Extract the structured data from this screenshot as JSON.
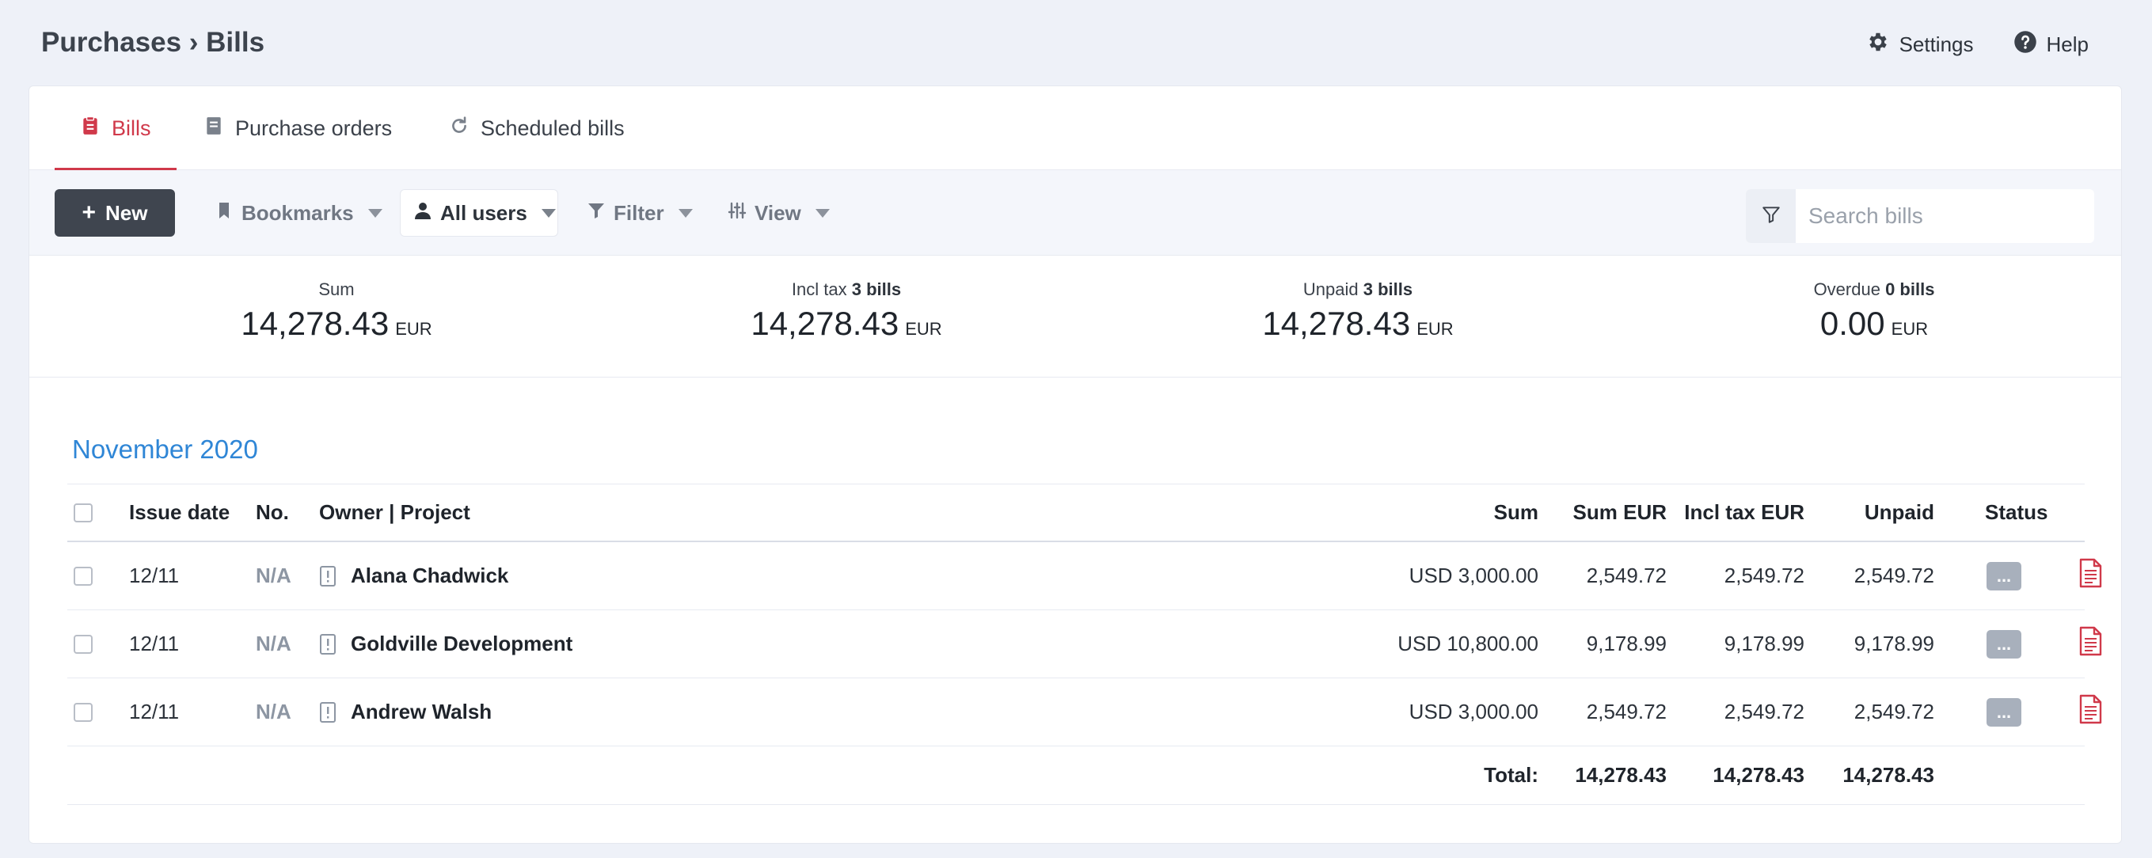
{
  "header": {
    "breadcrumb": "Purchases › Bills",
    "settings_label": "Settings",
    "help_label": "Help"
  },
  "tabs": [
    {
      "label": "Bills",
      "icon": "bills-icon",
      "active": true
    },
    {
      "label": "Purchase orders",
      "icon": "document-icon",
      "active": false
    },
    {
      "label": "Scheduled bills",
      "icon": "refresh-icon",
      "active": false
    }
  ],
  "toolbar": {
    "new_label": "New",
    "bookmarks_label": "Bookmarks",
    "users_label": "All users",
    "filter_label": "Filter",
    "view_label": "View",
    "search_placeholder": "Search bills"
  },
  "summary": {
    "sum": {
      "label": "Sum",
      "count": "",
      "value": "14,278.43",
      "currency": "EUR"
    },
    "incl_tax": {
      "label": "Incl tax",
      "count": "3 bills",
      "value": "14,278.43",
      "currency": "EUR"
    },
    "unpaid": {
      "label": "Unpaid",
      "count": "3 bills",
      "value": "14,278.43",
      "currency": "EUR"
    },
    "overdue": {
      "label": "Overdue",
      "count": "0 bills",
      "value": "0.00",
      "currency": "EUR"
    }
  },
  "month": "November 2020",
  "table": {
    "headers": {
      "issue_date": "Issue date",
      "no": "No.",
      "owner_project": "Owner | Project",
      "sum": "Sum",
      "sum_eur": "Sum EUR",
      "incl_tax_eur": "Incl tax EUR",
      "unpaid": "Unpaid",
      "status": "Status"
    },
    "rows": [
      {
        "date": "12/11",
        "no": "N/A",
        "owner": "Alana Chadwick",
        "sum": "USD 3,000.00",
        "sum_eur": "2,549.72",
        "incl_tax_eur": "2,549.72",
        "unpaid": "2,549.72",
        "status": "..."
      },
      {
        "date": "12/11",
        "no": "N/A",
        "owner": "Goldville Development",
        "sum": "USD 10,800.00",
        "sum_eur": "9,178.99",
        "incl_tax_eur": "9,178.99",
        "unpaid": "9,178.99",
        "status": "..."
      },
      {
        "date": "12/11",
        "no": "N/A",
        "owner": "Andrew Walsh",
        "sum": "USD 3,000.00",
        "sum_eur": "2,549.72",
        "incl_tax_eur": "2,549.72",
        "unpaid": "2,549.72",
        "status": "..."
      }
    ],
    "total": {
      "label": "Total:",
      "sum_eur": "14,278.43",
      "incl_tax_eur": "14,278.43",
      "unpaid": "14,278.43"
    }
  },
  "colors": {
    "accent_red": "#d0394a",
    "month_blue": "#2f86d6",
    "new_button": "#3f454f"
  }
}
